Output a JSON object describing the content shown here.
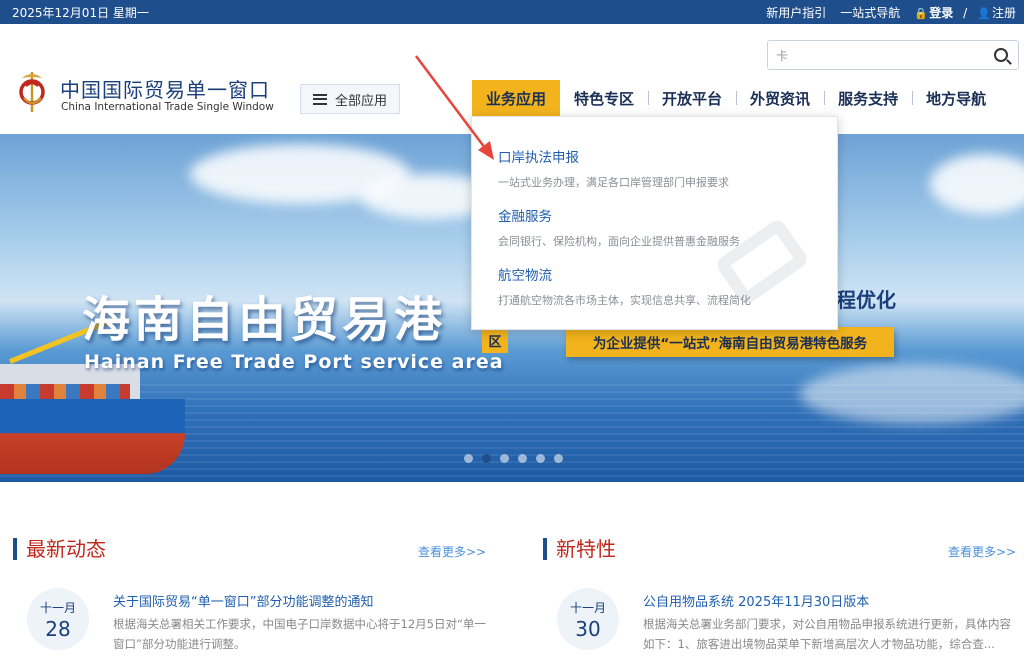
{
  "topbar": {
    "date": "2025年12月01日 星期一",
    "guide": "新用户指引",
    "nav": "一站式导航",
    "login": "登录",
    "sep": "/",
    "register": "注册"
  },
  "brand": {
    "name_cn": "中国国际贸易单一窗口",
    "name_en": "China International Trade Single Window"
  },
  "all_apps_label": "全部应用",
  "search": {
    "value": "卡"
  },
  "nav": [
    {
      "label": "业务应用"
    },
    {
      "label": "特色专区"
    },
    {
      "label": "开放平台"
    },
    {
      "label": "外贸资讯"
    },
    {
      "label": "服务支持"
    },
    {
      "label": "地方导航"
    }
  ],
  "dropdown": [
    {
      "title": "口岸执法申报",
      "desc": "一站式业务办理，满足各口岸管理部门申报要求"
    },
    {
      "title": "金融服务",
      "desc": "会同银行、保险机构，面向企业提供普惠金融服务"
    },
    {
      "title": "航空物流",
      "desc": "打通航空物流各市场主体，实现信息共享、流程简化"
    }
  ],
  "banner": {
    "headline": "海南自由贸易港",
    "headline_en": "Hainan Free Trade Port service area",
    "tag": "区",
    "slogan": "为企业提供“一站式”海南自由贸易港特色服务",
    "partial": "程优化"
  },
  "sections": [
    {
      "title": "最新动态",
      "more": "查看更多>>",
      "item": {
        "month": "十一月",
        "day": "28",
        "title": "关于国际贸易“单一窗口”部分功能调整的通知",
        "desc": "根据海关总署相关工作要求，中国电子口岸数据中心将于12月5日对“单一窗口”部分功能进行调整。"
      }
    },
    {
      "title": "新特性",
      "more": "查看更多>>",
      "item": {
        "month": "十一月",
        "day": "30",
        "title": "公自用物品系统 2025年11月30日版本",
        "desc": "根据海关总署业务部门要求，对公自用物品申报系统进行更新，具体内容如下：1、旅客进出境物品菜单下新增高层次人才物品功能，综合查..."
      }
    }
  ],
  "colors": {
    "topbar": "#1f4e8c",
    "accent": "#f2b31d",
    "section_title": "#c0281c",
    "link": "#1f5fae",
    "annotation_arrow": "#e8453c"
  }
}
